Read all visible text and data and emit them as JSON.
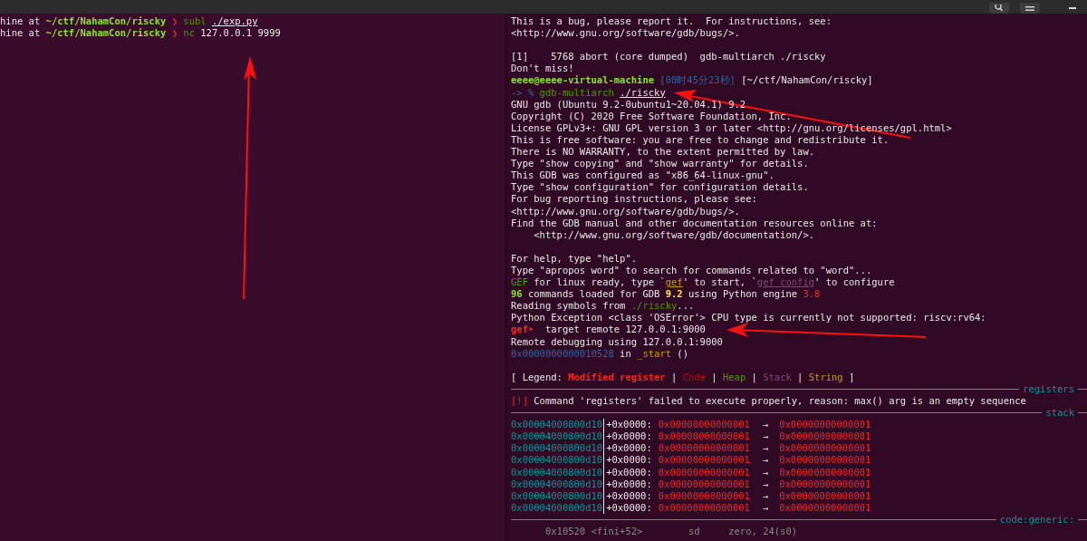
{
  "left_terminal": {
    "lines": [
      {
        "segments": [
          {
            "text": "hine at ",
            "kind": "plain"
          },
          {
            "text": "~/ctf/NahamCon/riscky",
            "kind": "path"
          },
          {
            "text": " ❯ ",
            "kind": "alert"
          },
          {
            "text": "subl ",
            "kind": "command"
          },
          {
            "text": "./exp.py",
            "kind": "argument"
          }
        ]
      },
      {
        "segments": [
          {
            "text": "hine at ",
            "kind": "plain"
          },
          {
            "text": "~/ctf/NahamCon/riscky",
            "kind": "path"
          },
          {
            "text": " ❯ ",
            "kind": "alert"
          },
          {
            "text": "nc",
            "kind": "command"
          },
          {
            "text": " 127.0.0.1 9999",
            "kind": "plain"
          }
        ]
      }
    ]
  },
  "right_terminal": {
    "lines": [
      {
        "kind": "text",
        "segments": [
          {
            "text": "This is a bug, please report it.  For instructions, see:",
            "kind": "plain"
          }
        ]
      },
      {
        "kind": "text",
        "segments": [
          {
            "text": "<http://www.gnu.org/software/gdb/bugs/>.",
            "kind": "plain"
          }
        ]
      },
      {
        "kind": "blank"
      },
      {
        "kind": "text",
        "segments": [
          {
            "text": "[1]    5768 abort (core dumped)  gdb-multiarch ./riscky",
            "kind": "plain"
          }
        ]
      },
      {
        "kind": "text",
        "segments": [
          {
            "text": "Don't miss!",
            "kind": "plain"
          }
        ]
      },
      {
        "kind": "text",
        "segments": [
          {
            "text": "eeee@eeee-virtual-machine",
            "kind": "path"
          },
          {
            "text": " [00时45分23秒]",
            "kind": "address"
          },
          {
            "text": " [~/ctf/NahamCon/riscky]",
            "kind": "plain"
          }
        ]
      },
      {
        "kind": "text",
        "segments": [
          {
            "text": "-> % ",
            "kind": "address"
          },
          {
            "text": "gdb-multiarch ",
            "kind": "command"
          },
          {
            "text": "./riscky",
            "kind": "argument"
          }
        ]
      },
      {
        "kind": "text",
        "segments": [
          {
            "text": "GNU gdb (Ubuntu 9.2-0ubuntu1~20.04.1) 9.2",
            "kind": "plain"
          }
        ]
      },
      {
        "kind": "text",
        "segments": [
          {
            "text": "Copyright (C) 2020 Free Software Foundation, Inc.",
            "kind": "plain"
          }
        ]
      },
      {
        "kind": "text",
        "segments": [
          {
            "text": "License GPLv3+: GNU GPL version 3 or later <http://gnu.org/licenses/gpl.html>",
            "kind": "plain"
          }
        ]
      },
      {
        "kind": "text",
        "segments": [
          {
            "text": "This is free software: you are free to change and redistribute it.",
            "kind": "plain"
          }
        ]
      },
      {
        "kind": "text",
        "segments": [
          {
            "text": "There is NO WARRANTY, to the extent permitted by law.",
            "kind": "plain"
          }
        ]
      },
      {
        "kind": "text",
        "segments": [
          {
            "text": "Type \"show copying\" and \"show warranty\" for details.",
            "kind": "plain"
          }
        ]
      },
      {
        "kind": "text",
        "segments": [
          {
            "text": "This GDB was configured as \"x86_64-linux-gnu\".",
            "kind": "plain"
          }
        ]
      },
      {
        "kind": "text",
        "segments": [
          {
            "text": "Type \"show configuration\" for configuration details.",
            "kind": "plain"
          }
        ]
      },
      {
        "kind": "text",
        "segments": [
          {
            "text": "For bug reporting instructions, please see:",
            "kind": "plain"
          }
        ]
      },
      {
        "kind": "text",
        "segments": [
          {
            "text": "<http://www.gnu.org/software/gdb/bugs/>.",
            "kind": "plain"
          }
        ]
      },
      {
        "kind": "text",
        "segments": [
          {
            "text": "Find the GDB manual and other documentation resources online at:",
            "kind": "plain"
          }
        ]
      },
      {
        "kind": "text",
        "segments": [
          {
            "text": "    <http://www.gnu.org/software/gdb/documentation/>.",
            "kind": "plain"
          }
        ]
      },
      {
        "kind": "blank"
      },
      {
        "kind": "text",
        "segments": [
          {
            "text": "For help, type \"help\".",
            "kind": "plain"
          }
        ]
      },
      {
        "kind": "text",
        "segments": [
          {
            "text": "Type \"apropos word\" to search for commands related to \"word\"...",
            "kind": "plain"
          }
        ]
      },
      {
        "kind": "text",
        "segments": [
          {
            "text": "GEF",
            "kind": "command"
          },
          {
            "text": " for linux ready, type `",
            "kind": "plain"
          },
          {
            "text": "gef",
            "kind": "link"
          },
          {
            "text": "' to start, `",
            "kind": "plain"
          },
          {
            "text": "gef config",
            "kind": "muted-link"
          },
          {
            "text": "' to configure",
            "kind": "plain"
          }
        ]
      },
      {
        "kind": "text",
        "segments": [
          {
            "text": "96",
            "kind": "path"
          },
          {
            "text": " commands loaded for GDB ",
            "kind": "plain"
          },
          {
            "text": "9.2",
            "kind": "version"
          },
          {
            "text": " using Python engine ",
            "kind": "plain"
          },
          {
            "text": "3.8",
            "kind": "error"
          }
        ]
      },
      {
        "kind": "text",
        "segments": [
          {
            "text": "Reading symbols from ",
            "kind": "plain"
          },
          {
            "text": "./riscky",
            "kind": "command"
          },
          {
            "text": "...",
            "kind": "plain"
          }
        ]
      },
      {
        "kind": "text",
        "segments": [
          {
            "text": "Python Exception <class 'OSError'> CPU type is currently not supported: riscv:rv64:",
            "kind": "plain"
          }
        ]
      },
      {
        "kind": "text",
        "segments": [
          {
            "text": "gef➤ ",
            "kind": "alert"
          },
          {
            "text": " target remote 127.0.0.1:9000",
            "kind": "plain"
          }
        ]
      },
      {
        "kind": "text",
        "segments": [
          {
            "text": "Remote debugging using 127.0.0.1:9000",
            "kind": "plain"
          }
        ]
      },
      {
        "kind": "text",
        "segments": [
          {
            "text": "0x0000000000010528",
            "kind": "address"
          },
          {
            "text": " in ",
            "kind": "plain"
          },
          {
            "text": "_start",
            "kind": "symbol"
          },
          {
            "text": " ()",
            "kind": "plain"
          }
        ]
      },
      {
        "kind": "blank"
      },
      {
        "kind": "text",
        "segments": [
          {
            "text": "[ Legend: ",
            "kind": "plain"
          },
          {
            "text": "Modified register",
            "kind": "alert"
          },
          {
            "text": " | ",
            "kind": "plain"
          },
          {
            "text": "Code",
            "kind": "code"
          },
          {
            "text": " | ",
            "kind": "plain"
          },
          {
            "text": "Heap",
            "kind": "command"
          },
          {
            "text": " | ",
            "kind": "plain"
          },
          {
            "text": "Stack",
            "kind": "stack"
          },
          {
            "text": " | ",
            "kind": "plain"
          },
          {
            "text": "String",
            "kind": "symbol"
          },
          {
            "text": " ]",
            "kind": "plain"
          }
        ]
      },
      {
        "kind": "rule",
        "label": "registers"
      },
      {
        "kind": "text",
        "segments": [
          {
            "text": "[!]",
            "kind": "error"
          },
          {
            "text": " Command 'registers' failed to execute properly, reason: max() arg is an empty sequence",
            "kind": "plain"
          }
        ]
      },
      {
        "kind": "rule",
        "label": "stack"
      },
      {
        "kind": "stack",
        "address": "0x00004000800d10",
        "offset": "+0x0000:",
        "value": "0x00000000000001",
        "arrow": "→",
        "target": "0x00000000000001"
      },
      {
        "kind": "stack",
        "address": "0x00004000800d10",
        "offset": "+0x0000:",
        "value": "0x00000000000001",
        "arrow": "→",
        "target": "0x00000000000001"
      },
      {
        "kind": "stack",
        "address": "0x00004000800d10",
        "offset": "+0x0000:",
        "value": "0x00000000000001",
        "arrow": "→",
        "target": "0x00000000000001"
      },
      {
        "kind": "stack",
        "address": "0x00004000800d10",
        "offset": "+0x0000:",
        "value": "0x00000000000001",
        "arrow": "→",
        "target": "0x00000000000001"
      },
      {
        "kind": "stack",
        "address": "0x00004000800d10",
        "offset": "+0x0000:",
        "value": "0x00000000000001",
        "arrow": "→",
        "target": "0x00000000000001"
      },
      {
        "kind": "stack",
        "address": "0x00004000800d10",
        "offset": "+0x0000:",
        "value": "0x00000000000001",
        "arrow": "→",
        "target": "0x00000000000001"
      },
      {
        "kind": "stack",
        "address": "0x00004000800d10",
        "offset": "+0x0000:",
        "value": "0x00000000000001",
        "arrow": "→",
        "target": "0x00000000000001"
      },
      {
        "kind": "stack",
        "address": "0x00004000800d10",
        "offset": "+0x0000:",
        "value": "0x00000000000001",
        "arrow": "→",
        "target": "0x00000000000001"
      },
      {
        "kind": "rule",
        "label": "code:generic:"
      },
      {
        "kind": "text",
        "segments": [
          {
            "text": "      0x10520 <fini+52>        sd     zero, 24(s0)",
            "kind": "dim"
          }
        ]
      }
    ]
  }
}
